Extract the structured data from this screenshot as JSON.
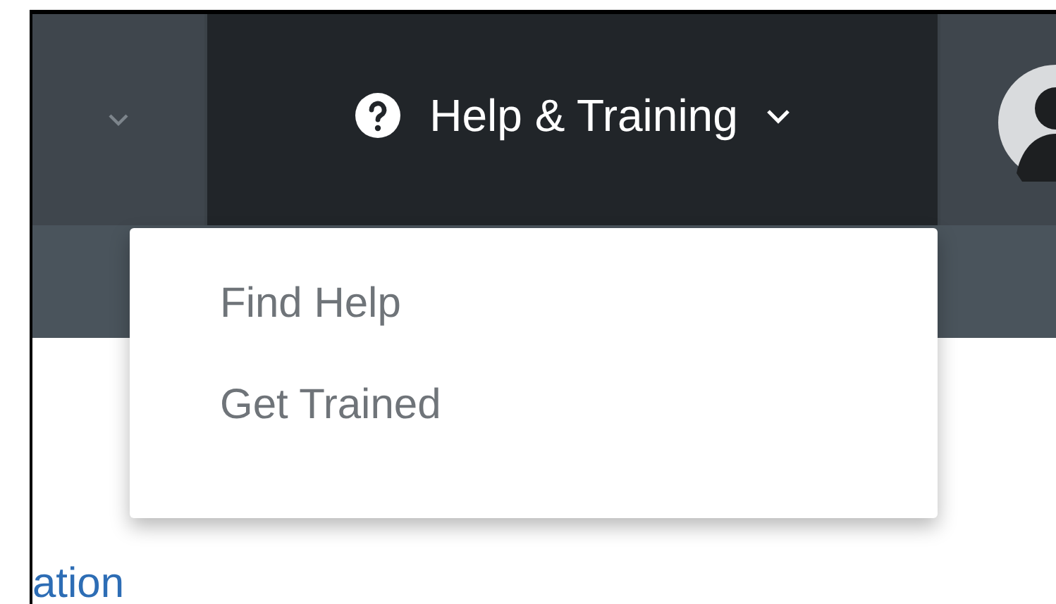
{
  "nav": {
    "help_menu": {
      "label": "Help & Training",
      "expanded": true,
      "items": [
        {
          "label": "Find Help"
        },
        {
          "label": "Get Trained"
        }
      ]
    }
  },
  "body": {
    "link_fragment": "ation"
  }
}
